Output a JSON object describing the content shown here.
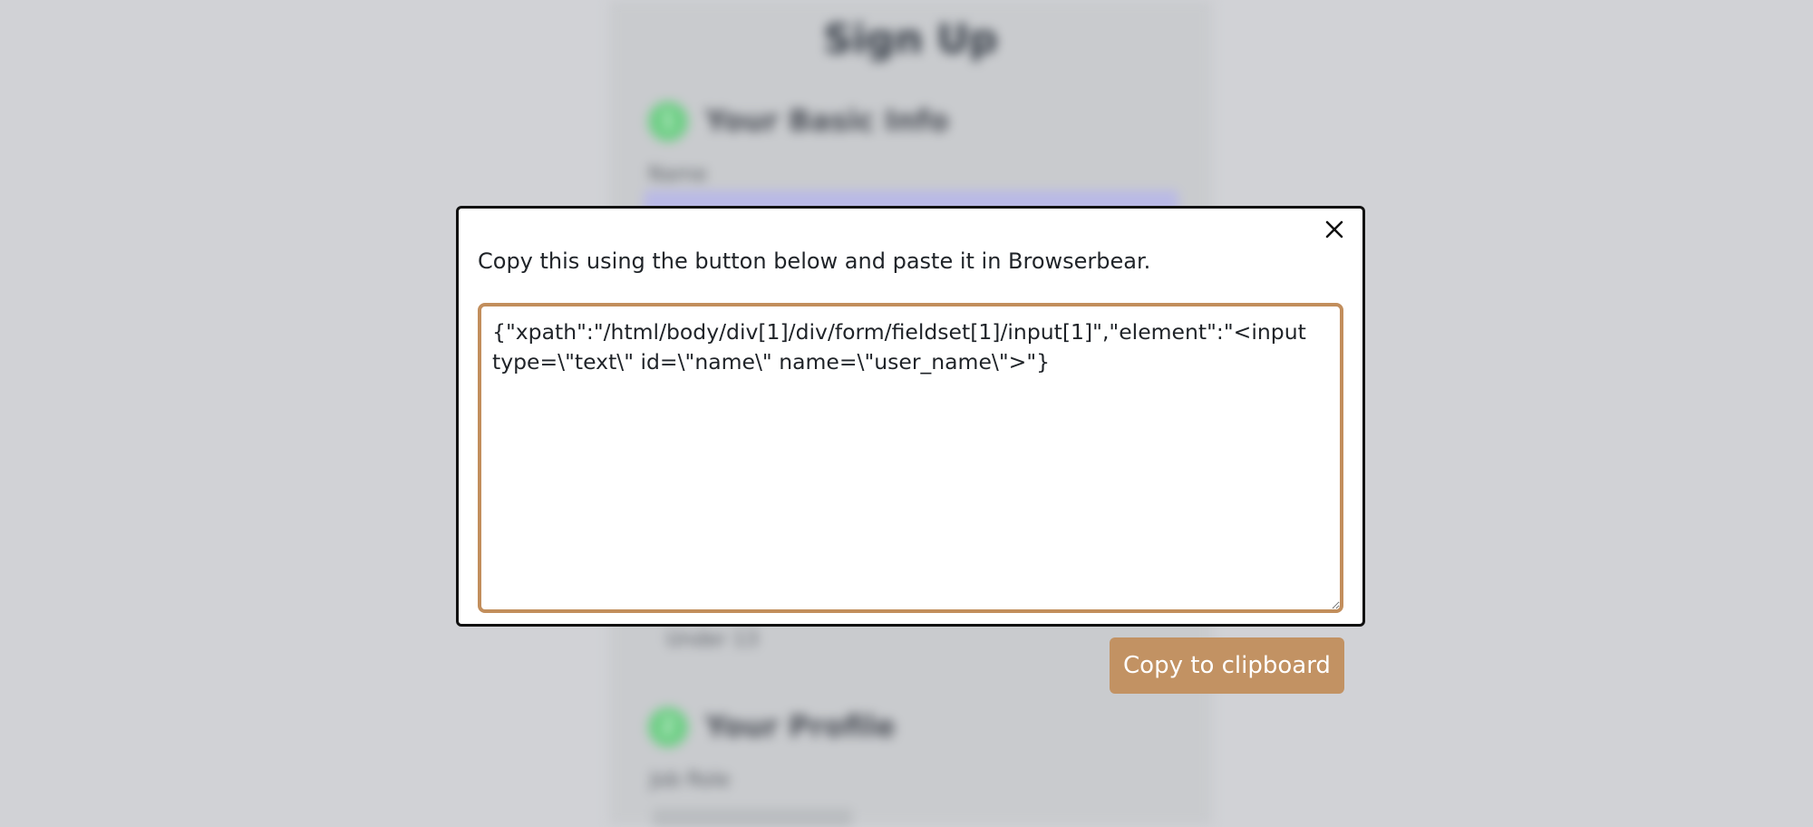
{
  "background_page": {
    "title": "Sign Up",
    "section_1": {
      "step": "1",
      "title": "Your Basic Info",
      "label": "Name"
    },
    "section_2": {
      "step": "2",
      "title": "Your Profile",
      "label": "Job Role"
    },
    "faint_link": "Under 13"
  },
  "modal": {
    "instructions": "Copy this using the button below and paste it in Browserbear.",
    "code_value": "{\"xpath\":\"/html/body/div[1]/div/form/fieldset[1]/input[1]\",\"element\":\"<input type=\\\"text\\\" id=\\\"name\\\" name=\\\"user_name\\\">\"}",
    "copy_button_label": "Copy to clipboard",
    "close_icon": "close-icon"
  },
  "colors": {
    "accent": "#c28e5c",
    "button": "#c29263",
    "overlay": "#d1d2d6",
    "modal_border": "#111111"
  }
}
